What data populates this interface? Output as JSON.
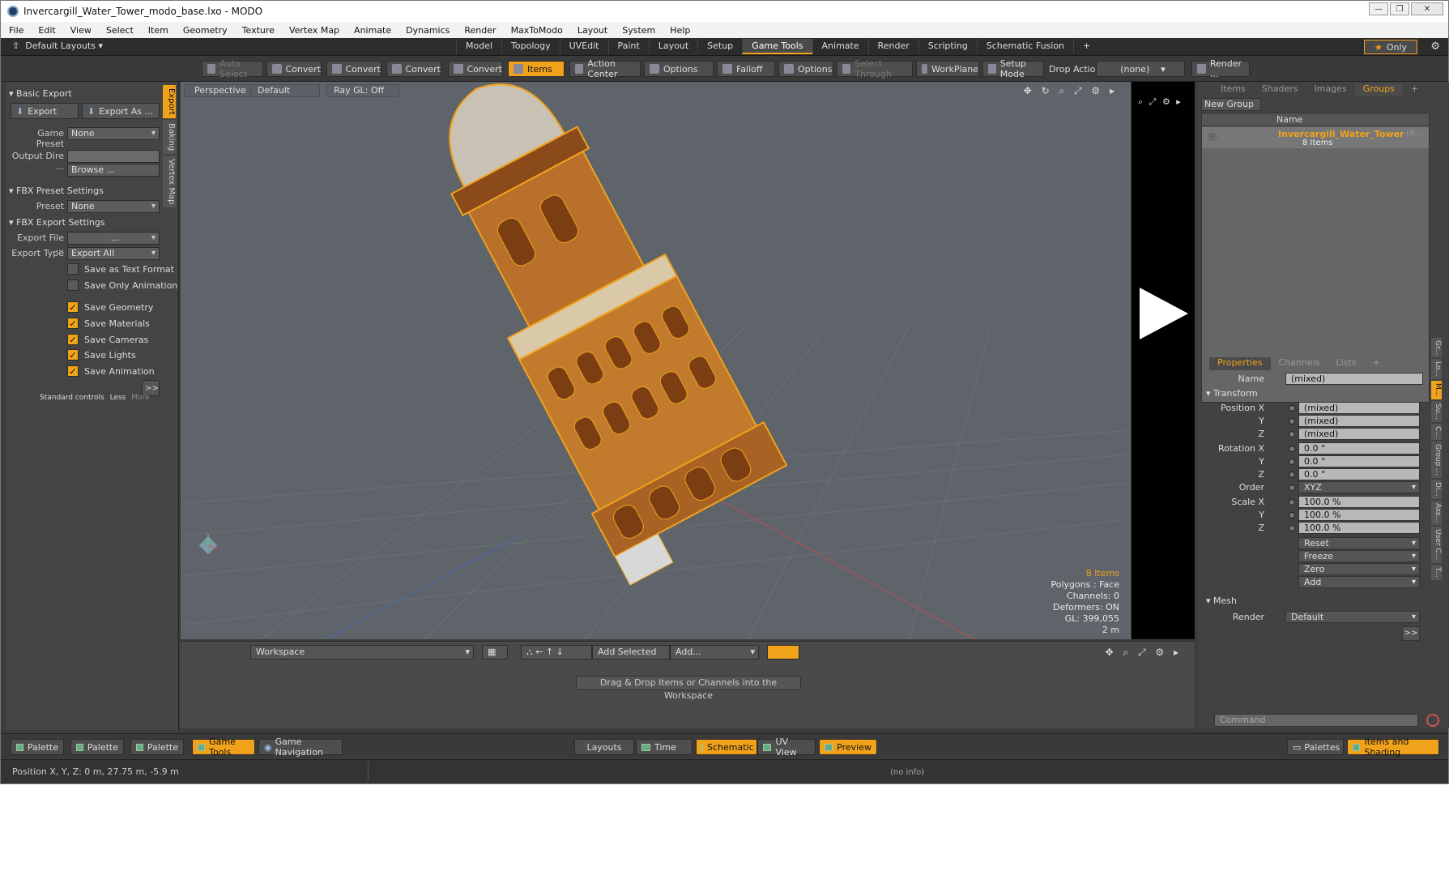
{
  "window": {
    "title": "Invercargill_Water_Tower_modo_base.lxo - MODO"
  },
  "menu": [
    "File",
    "Edit",
    "View",
    "Select",
    "Item",
    "Geometry",
    "Texture",
    "Vertex Map",
    "Animate",
    "Dynamics",
    "Render",
    "MaxToModo",
    "Layout",
    "System",
    "Help"
  ],
  "layout_bar": {
    "default_layouts": "Default Layouts",
    "tabs": [
      "Model",
      "Topology",
      "UVEdit",
      "Paint",
      "Layout",
      "Setup",
      "Game Tools",
      "Animate",
      "Render",
      "Scripting",
      "Schematic Fusion",
      "+"
    ],
    "active_tab": "Game Tools",
    "only_label": "Only"
  },
  "toolbar": {
    "auto_select": "Auto Select",
    "convert_1": "Convert",
    "convert_2": "Convert",
    "convert_3": "Convert",
    "convert_4": "Convert",
    "items": "Items",
    "action_center": "Action Center",
    "options_1": "Options",
    "falloff": "Falloff",
    "options_2": "Options",
    "select_through": "Select Through",
    "workplane": "WorkPlane",
    "setup_mode": "Setup Mode",
    "drop_action_label": "Drop Action",
    "drop_action_value": "(none)",
    "render": "Render ..."
  },
  "left_panel": {
    "vtabs": [
      "Export",
      "Baking",
      "Vertex Map"
    ],
    "basic_export": "Basic Export",
    "export_btn": "Export",
    "export_as_btn": "Export As ...",
    "game_preset_label": "Game Preset",
    "game_preset_value": "None",
    "output_dir_label": "Output Dire ...",
    "browse_btn": "Browse ...",
    "fbx_preset_settings": "FBX Preset Settings",
    "preset_label": "Preset",
    "preset_value": "None",
    "fbx_export_settings": "FBX Export Settings",
    "export_file_label": "Export File ...",
    "export_file_value": "...",
    "export_type_label": "Export Type",
    "export_type_value": "Export All",
    "checkboxes": [
      {
        "label": "Save as Text Format",
        "checked": false
      },
      {
        "label": "Save Only Animation",
        "checked": false
      },
      {
        "label": "Save Geometry",
        "checked": true
      },
      {
        "label": "Save Materials",
        "checked": true
      },
      {
        "label": "Save Cameras",
        "checked": true
      },
      {
        "label": "Save Lights",
        "checked": true
      },
      {
        "label": "Save Animation",
        "checked": true
      }
    ],
    "expand_btn": ">>",
    "standard_controls": "Standard controls",
    "less": "Less",
    "more": "More"
  },
  "viewport": {
    "perspective": "Perspective",
    "default": "Default",
    "ray_gl": "Ray GL: Off",
    "info": {
      "items": "8 Items",
      "polygons": "Polygons : Face",
      "channels": "Channels: 0",
      "deformers": "Deformers: ON",
      "gl": "GL: 399,055",
      "scale": "2 m"
    }
  },
  "right_panel": {
    "tabs": [
      "Items",
      "Shaders",
      "Images",
      "Groups",
      "+"
    ],
    "active_tab": "Groups",
    "new_group": "New Group",
    "name_header": "Name",
    "group_name": "Invercargill_Water_Tower",
    "group_suffix": "(9...",
    "group_count": "8 Items",
    "prop_tabs": [
      "Properties",
      "Channels",
      "Lists",
      "+"
    ],
    "prop_active": "Properties",
    "name_label": "Name",
    "name_value": "(mixed)",
    "transform": "Transform",
    "position_x_label": "Position X",
    "y_label": "Y",
    "z_label": "Z",
    "pos_x": "(mixed)",
    "pos_y": "(mixed)",
    "pos_z": "(mixed)",
    "rotation_x_label": "Rotation X",
    "rot_x": "0.0 °",
    "rot_y": "0.0 °",
    "rot_z": "0.0 °",
    "order_label": "Order",
    "order_value": "XYZ",
    "scale_x_label": "Scale X",
    "scale_x": "100.0 %",
    "scale_y": "100.0 %",
    "scale_z": "100.0 %",
    "actions": [
      "Reset",
      "Freeze",
      "Zero",
      "Add"
    ],
    "mesh": "Mesh",
    "render_label": "Render",
    "render_value": "Default",
    "expand_btn": ">>",
    "vtabs": [
      "Gr...",
      "Lo...",
      "M...",
      "Su...",
      "C...",
      "Group ...",
      "Di...",
      "Ass...",
      "User C...",
      "T..."
    ],
    "command_placeholder": "Command"
  },
  "workspace": {
    "name": "Workspace",
    "add_selected": "Add Selected",
    "add": "Add...",
    "hint": "Drag & Drop Items or Channels into the Workspace"
  },
  "bottom_bar": {
    "palette_1": "Palette",
    "palette_2": "Palette",
    "palette_3": "Palette",
    "game_tools": "Game Tools",
    "game_navigation": "Game Navigation",
    "layouts": "Layouts",
    "time": "Time",
    "schematic": "Schematic",
    "uv_view": "UV View",
    "preview": "Preview",
    "palettes": "Palettes",
    "items_and_shading": "Items and Shading"
  },
  "status": {
    "position": "Position X, Y, Z:  0 m, 27.75 m, -5.9 m",
    "info": "(no info)"
  },
  "colors": {
    "accent": "#f1a21b",
    "viewport_bg": "#5e646a",
    "panel_bg": "#444444"
  }
}
